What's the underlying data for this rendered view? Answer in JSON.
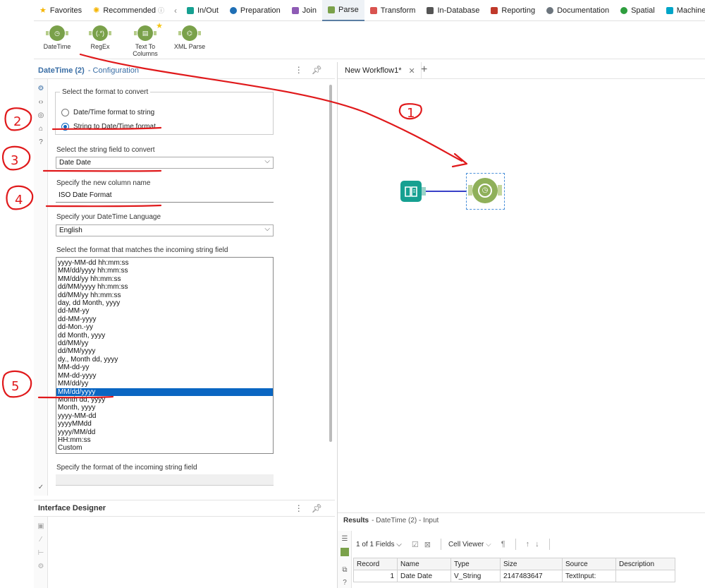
{
  "category_tabs": [
    {
      "label": "Favorites",
      "color": "#f5b400",
      "icon": "star-icon"
    },
    {
      "label": "Recommended",
      "color": "#f5b400",
      "icon": "sparkle-icon"
    },
    {
      "label": "In/Out",
      "color": "#16a091",
      "icon": "inout-icon"
    },
    {
      "label": "Preparation",
      "color": "#1f6fb5",
      "icon": "preparation-icon"
    },
    {
      "label": "Join",
      "color": "#8e5bb5",
      "icon": "join-icon"
    },
    {
      "label": "Parse",
      "color": "#7aa14a",
      "icon": "parse-icon"
    },
    {
      "label": "Transform",
      "color": "#d9534f",
      "icon": "transform-icon"
    },
    {
      "label": "In-Database",
      "color": "#555555",
      "icon": "database-icon"
    },
    {
      "label": "Reporting",
      "color": "#c0392b",
      "icon": "reporting-icon"
    },
    {
      "label": "Documentation",
      "color": "#6c757d",
      "icon": "documentation-icon"
    },
    {
      "label": "Spatial",
      "color": "#2e9e3e",
      "icon": "spatial-icon"
    },
    {
      "label": "Machine Learning",
      "color": "#00a5c8",
      "icon": "ml-icon"
    }
  ],
  "palette_tools": [
    {
      "label": "DateTime",
      "icon": "datetime-icon"
    },
    {
      "label": "RegEx",
      "icon": "regex-icon"
    },
    {
      "label": "Text To Columns",
      "icon": "text-to-columns-icon"
    },
    {
      "label": "XML Parse",
      "icon": "xml-parse-icon"
    }
  ],
  "config": {
    "title": "DateTime (2)",
    "subtitle": "- Configuration",
    "group_legend": "Select the format to convert",
    "radio_1": "Date/Time format to string",
    "radio_2": "String to Date/Time format",
    "field_label": "Select the string field to convert",
    "field_value": "Date Date",
    "column_label": "Specify the new column name",
    "column_value": "ISO Date Format",
    "language_label": "Specify your DateTime Language",
    "language_value": "English",
    "format_label": "Select the format that matches the incoming string field",
    "formats": [
      "yyyy-MM-dd hh:mm:ss",
      "MM/dd/yyyy hh:mm:ss",
      "MM/dd/yy hh:mm:ss",
      "dd/MM/yyyy hh:mm:ss",
      "dd/MM/yy hh:mm:ss",
      "day, dd Month, yyyy",
      "dd-MM-yy",
      "dd-MM-yyyy",
      "dd-Mon.-yy",
      "dd Month, yyyy",
      "dd/MM/yy",
      "dd/MM/yyyy",
      "dy., Month dd, yyyy",
      "MM-dd-yy",
      "MM-dd-yyyy",
      "MM/dd/yy",
      "MM/dd/yyyy",
      "Month dd, yyyy",
      "Month, yyyy",
      "yyyy-MM-dd",
      "yyyyMMdd",
      "yyyy/MM/dd",
      "HH:mm:ss",
      "Custom"
    ],
    "selected_format": "MM/dd/yyyy",
    "custom_label": "Specify the format of the incoming string field"
  },
  "interface_designer": {
    "title": "Interface Designer"
  },
  "canvas": {
    "tab_label": "New Workflow1*"
  },
  "results": {
    "title": "Results",
    "subtitle": "- DateTime (2) - Input",
    "fields_label": "1 of 1 Fields",
    "cell_viewer_label": "Cell Viewer",
    "columns": [
      "Record",
      "Name",
      "Type",
      "Size",
      "Source",
      "Description"
    ],
    "rows": [
      [
        "1",
        "Date Date",
        "V_String",
        "2147483647",
        "TextInput:",
        ""
      ]
    ]
  },
  "annotations": [
    "1",
    "2",
    "3",
    "4",
    "5"
  ],
  "annotation_color": "#e0191b"
}
